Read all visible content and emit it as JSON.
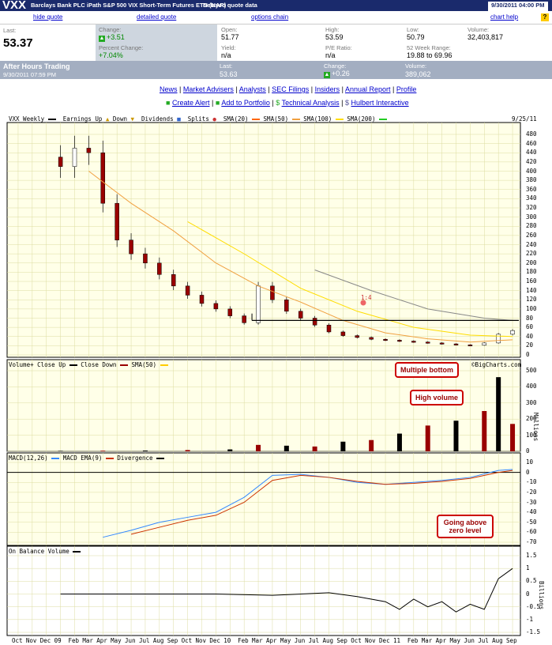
{
  "header": {
    "symbol": "VXX",
    "name": "Barclays Bank PLC iPath S&P 500 VIX Short-Term Futures ETN (NAR)",
    "delay_note": "Delayed quote data",
    "datetime": "9/30/2011 04:00 PM"
  },
  "tabs": {
    "hide_quote": "hide quote",
    "detailed_quote": "detailed quote",
    "options_chain": "options chain",
    "chart_help": "chart help"
  },
  "quote": {
    "last_label": "Last:",
    "last": "53.37",
    "change_label": "Change:",
    "change": "+3.51",
    "pct_label": "Percent Change:",
    "pct": "+7.04%",
    "open_label": "Open:",
    "open": "51.77",
    "yield_label": "Yield:",
    "yield": "n/a",
    "high_label": "High:",
    "high": "53.59",
    "pe_label": "P/E Ratio:",
    "pe": "n/a",
    "low_label": "Low:",
    "low": "50.79",
    "range_label": "52 Week Range:",
    "range": "19.88 to 69.96",
    "volume_label": "Volume:",
    "volume": "32,403,817"
  },
  "after_hours": {
    "title": "After Hours Trading",
    "time": "9/30/2011 07:59 PM",
    "last_label": "Last:",
    "last": "53.63",
    "change_label": "Change:",
    "change": "+0.26",
    "volume_label": "Volume:",
    "volume": "389,062"
  },
  "nav_links": [
    "News",
    "Market Advisers",
    "Analysts",
    "SEC Filings",
    "Insiders",
    "Annual Report",
    "Profile"
  ],
  "tool_links": [
    "Create Alert",
    "Add to Portfolio",
    "Technical Analysis",
    "Hulbert Interactive"
  ],
  "price_panel": {
    "legend": {
      "title": "VXX Weekly",
      "earnings": "Earnings Up",
      "down": "Down",
      "dividends": "Dividends",
      "splits": "Splits",
      "sma20": "SMA(20)",
      "sma50": "SMA(50)",
      "sma100": "SMA(100)",
      "sma200": "SMA(200)"
    },
    "date": "9/25/11",
    "split_label": "1:4",
    "colors": {
      "sma20": "#ff6600",
      "sma50": "#f0a040",
      "sma100": "#ffdd00",
      "sma200": "#888888",
      "up": "#ffffff",
      "down": "#990000"
    }
  },
  "volume_panel": {
    "legend": {
      "title": "Volume+",
      "close_up": "Close Up",
      "close_down": "Close Down",
      "sma50": "SMA(50)"
    },
    "credit": "©BigCharts.com",
    "unit": "Millions"
  },
  "macd_panel": {
    "legend": {
      "title": "MACD(12,26)",
      "ema": "MACD EMA(9)",
      "divergence": "Divergence"
    }
  },
  "obv_panel": {
    "legend": {
      "title": "On Balance Volume"
    },
    "unit": "Billions"
  },
  "annotations": {
    "multiple_bottom": "Multiple bottom",
    "high_volume": "High volume",
    "zero_level": "Going above zero level"
  },
  "chart_data": [
    {
      "type": "line",
      "title": "VXX Weekly",
      "y_ticks": [
        0,
        20,
        40,
        60,
        80,
        100,
        120,
        140,
        160,
        180,
        200,
        220,
        240,
        260,
        280,
        300,
        320,
        340,
        360,
        380,
        400,
        420,
        440,
        460,
        480
      ],
      "ylim": [
        0,
        480
      ],
      "x_ticks": [
        "Oct",
        "Nov",
        "Dec",
        "09",
        "Feb",
        "Mar",
        "Apr",
        "May",
        "Jun",
        "Jul",
        "Aug",
        "Sep",
        "Oct",
        "Nov",
        "Dec",
        "10",
        "Feb",
        "Mar",
        "Apr",
        "May",
        "Jun",
        "Jul",
        "Aug",
        "Sep",
        "Oct",
        "Nov",
        "Dec",
        "11",
        "Feb",
        "Mar",
        "Apr",
        "May",
        "Jun",
        "Jul",
        "Aug",
        "Sep"
      ],
      "series": [
        {
          "name": "Close",
          "x": [
            0,
            1,
            2,
            3,
            4,
            5,
            6,
            7,
            8,
            9,
            10,
            11,
            12,
            13,
            14,
            15,
            16,
            17,
            18,
            19,
            20,
            21,
            22,
            23,
            24,
            25,
            26,
            27,
            28,
            29,
            30,
            31,
            32,
            33,
            34,
            35
          ],
          "values": [
            null,
            null,
            null,
            410,
            450,
            440,
            330,
            250,
            220,
            200,
            175,
            150,
            130,
            112,
            100,
            85,
            70,
            150,
            120,
            95,
            80,
            65,
            50,
            42,
            38,
            34,
            32,
            30,
            28,
            26,
            24,
            22,
            21,
            26,
            45,
            53
          ]
        },
        {
          "name": "SMA(50)",
          "x": [
            5,
            8,
            11,
            14,
            17,
            20,
            23,
            26,
            29,
            32,
            35
          ],
          "values": [
            400,
            330,
            270,
            200,
            150,
            115,
            75,
            48,
            35,
            28,
            33
          ]
        },
        {
          "name": "SMA(100)",
          "x": [
            12,
            16,
            20,
            24,
            28,
            32,
            35
          ],
          "values": [
            290,
            220,
            145,
            95,
            60,
            43,
            40
          ]
        },
        {
          "name": "SMA(200)",
          "x": [
            21,
            25,
            29,
            33,
            35
          ],
          "values": [
            185,
            140,
            100,
            80,
            75
          ]
        }
      ]
    },
    {
      "type": "bar",
      "title": "Volume+",
      "ylabel": "Millions",
      "y_ticks": [
        0,
        100,
        200,
        300,
        400,
        500
      ],
      "ylim": [
        0,
        500
      ],
      "x": [
        3,
        6,
        9,
        12,
        15,
        17,
        19,
        21,
        23,
        25,
        27,
        29,
        31,
        33,
        34,
        35
      ],
      "values": [
        3,
        4,
        5,
        8,
        12,
        40,
        35,
        30,
        60,
        70,
        110,
        160,
        190,
        250,
        460,
        170
      ]
    },
    {
      "type": "line",
      "title": "MACD(12,26)",
      "y_ticks": [
        10,
        0,
        -10,
        -20,
        -30,
        -40,
        -50,
        -60,
        -70
      ],
      "ylim": [
        -70,
        10
      ],
      "series": [
        {
          "name": "MACD(12,26)",
          "x": [
            6,
            8,
            10,
            12,
            14,
            16,
            18,
            20,
            22,
            24,
            26,
            28,
            30,
            32,
            34,
            35
          ],
          "values": [
            -65,
            -58,
            -50,
            -45,
            -40,
            -25,
            -3,
            -2,
            -5,
            -10,
            -12,
            -10,
            -8,
            -5,
            2,
            3
          ]
        },
        {
          "name": "MACD EMA(9)",
          "x": [
            8,
            10,
            12,
            14,
            16,
            18,
            20,
            22,
            24,
            26,
            28,
            30,
            32,
            34,
            35
          ],
          "values": [
            -62,
            -55,
            -48,
            -43,
            -30,
            -8,
            -3,
            -5,
            -9,
            -12,
            -11,
            -9,
            -6,
            0,
            2
          ]
        }
      ]
    },
    {
      "type": "line",
      "title": "On Balance Volume",
      "ylabel": "Billions",
      "y_ticks": [
        1.5,
        1.0,
        0.5,
        0.0,
        -0.5,
        -1.0,
        -1.5
      ],
      "ylim": [
        -1.5,
        1.5
      ],
      "series": [
        {
          "name": "On Balance Volume",
          "x": [
            3,
            8,
            14,
            18,
            22,
            24,
            26,
            27,
            28,
            29,
            30,
            31,
            32,
            33,
            34,
            35
          ],
          "values": [
            0,
            0,
            0,
            -0.05,
            0.05,
            -0.1,
            -0.3,
            -0.6,
            -0.2,
            -0.5,
            -0.3,
            -0.7,
            -0.4,
            -0.6,
            0.6,
            1.0
          ]
        }
      ]
    }
  ]
}
